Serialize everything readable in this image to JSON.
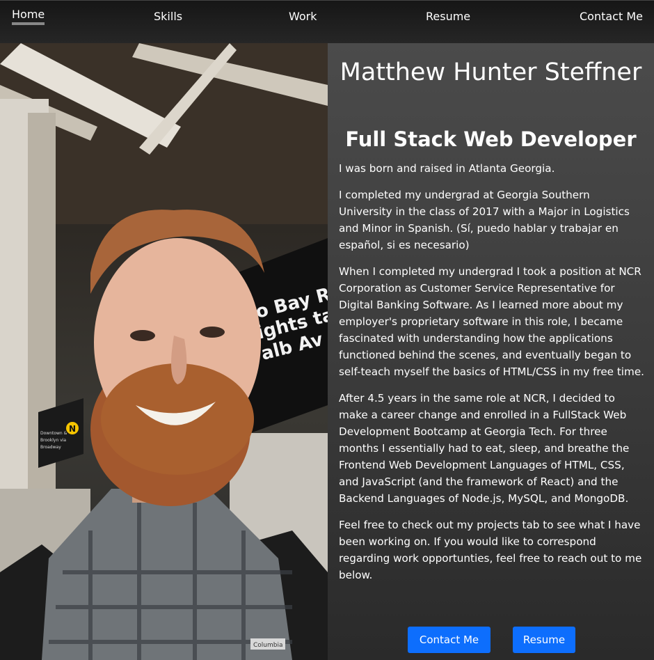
{
  "nav": {
    "home": "Home",
    "skills": "Skills",
    "work": "Work",
    "resume": "Resume",
    "contact": "Contact Me"
  },
  "hero": {
    "name": "Matthew Hunter Steffner",
    "title": "Full Stack Web Developer",
    "paragraphs": [
      "I was born and raised in Atlanta Georgia.",
      "I completed my undergrad at Georgia Southern University in the class of 2017 with a Major in Logistics and Minor in Spanish. (Sí, puedo hablar y trabajar en español, si es necesario)",
      "When I completed my undergrad I took a position at NCR Corporation as Customer Service Representative for Digital Banking Software. As I learned more about my employer's proprietary software in this role, I became fascinated with understanding how the applications functioned behind the scenes, and eventually began to self-teach myself the basics of HTML/CSS in my free time.",
      "After 4.5 years in the same role at NCR, I decided to make a career change and enrolled in a FullStack Web Development Bootcamp at Georgia Tech. For three months I essentially had to eat, sleep, and breathe the Frontend Web Development Languages of HTML, CSS, and JavaScript (and the framework of React) and the Backend Languages of Node.js, MySQL, and MongoDB.",
      "Feel free to check out my projects tab to see what I have been working on. If you would like to correspond regarding work opportunties, feel free to reach out to me below."
    ]
  },
  "buttons": {
    "contact": "Contact Me",
    "resume": "Resume"
  },
  "photo": {
    "sign_text": [
      "o Bay Ri",
      "ights tak",
      "alb Av fo"
    ],
    "sign_letter": "N",
    "small_sign": [
      "Downtown &",
      "Brooklyn via",
      "Broadway"
    ],
    "shirt_label": "Columbia"
  },
  "colors": {
    "nav_bg": "#1f1f1f",
    "panel_bg": "#3c3c3c",
    "button": "#0d6efd",
    "active_underline": "#888888"
  }
}
